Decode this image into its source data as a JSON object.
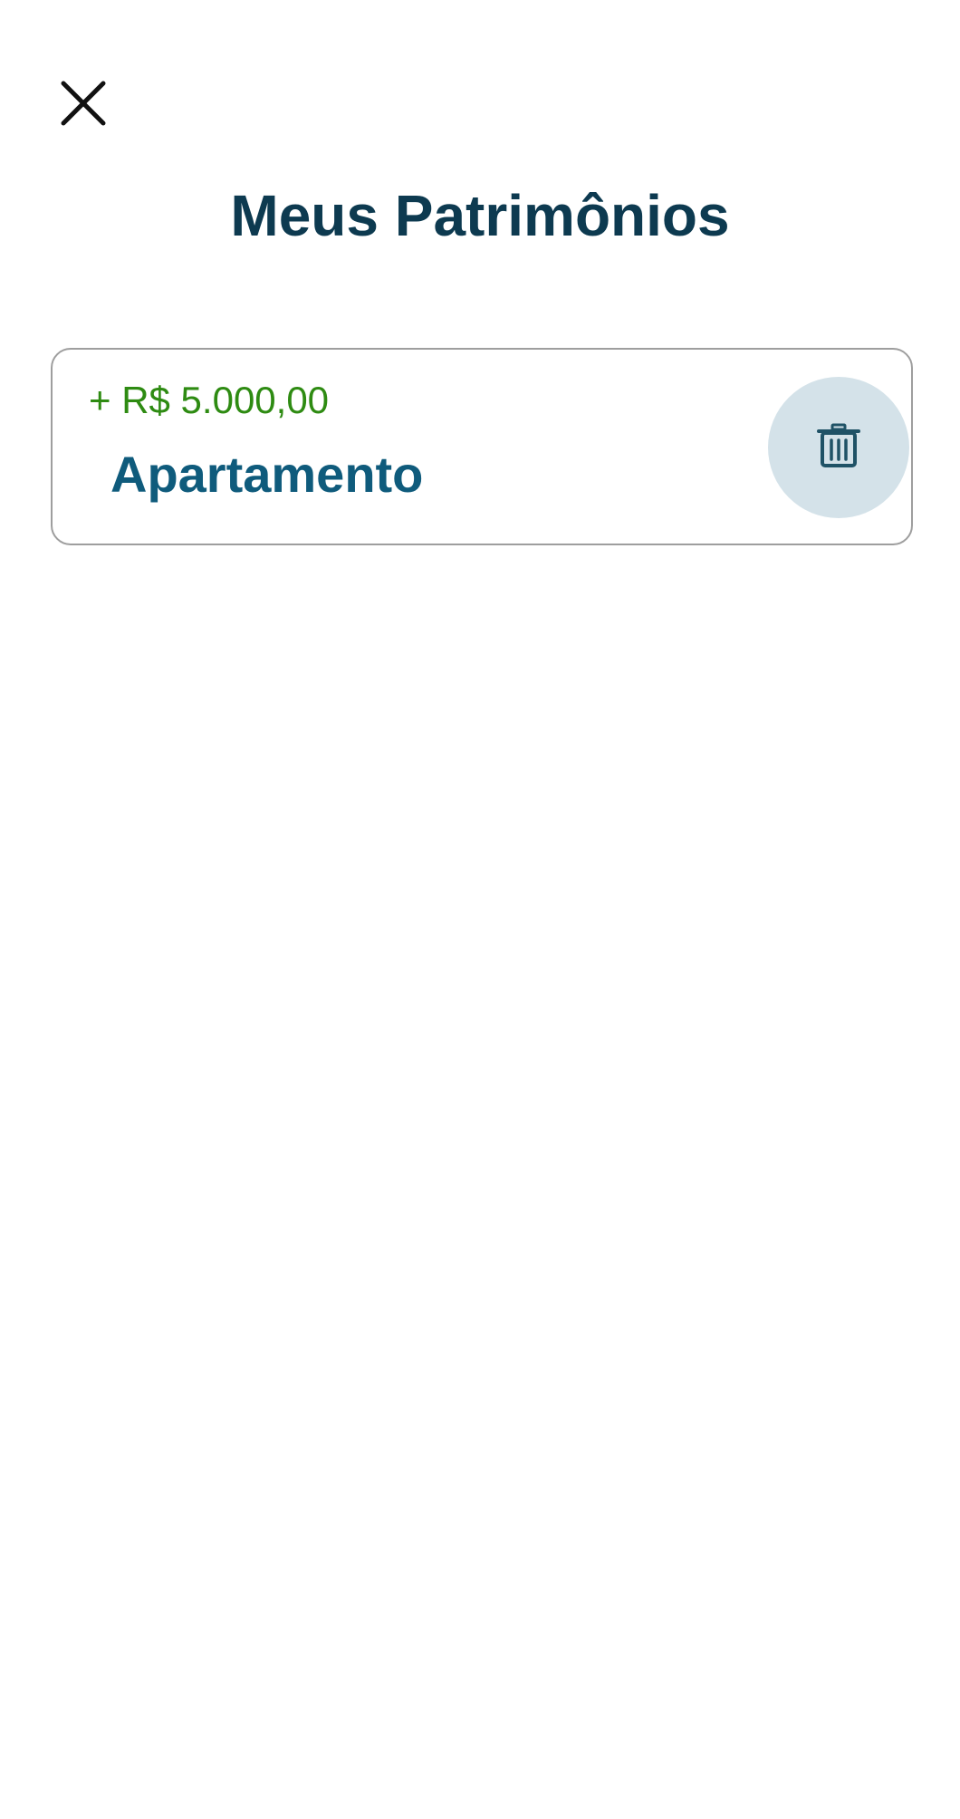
{
  "header": {
    "close_icon": "close-icon",
    "title": "Meus Patrimônios"
  },
  "assets": [
    {
      "value": "+ R$ 5.000,00",
      "name": "Apartamento",
      "delete_icon": "trash-icon"
    }
  ],
  "colors": {
    "title": "#0d3a50",
    "value_positive": "#2e8b12",
    "asset_name": "#0f5b7c",
    "delete_button_bg": "#d4e2e9",
    "card_border": "#9e9e9e"
  }
}
